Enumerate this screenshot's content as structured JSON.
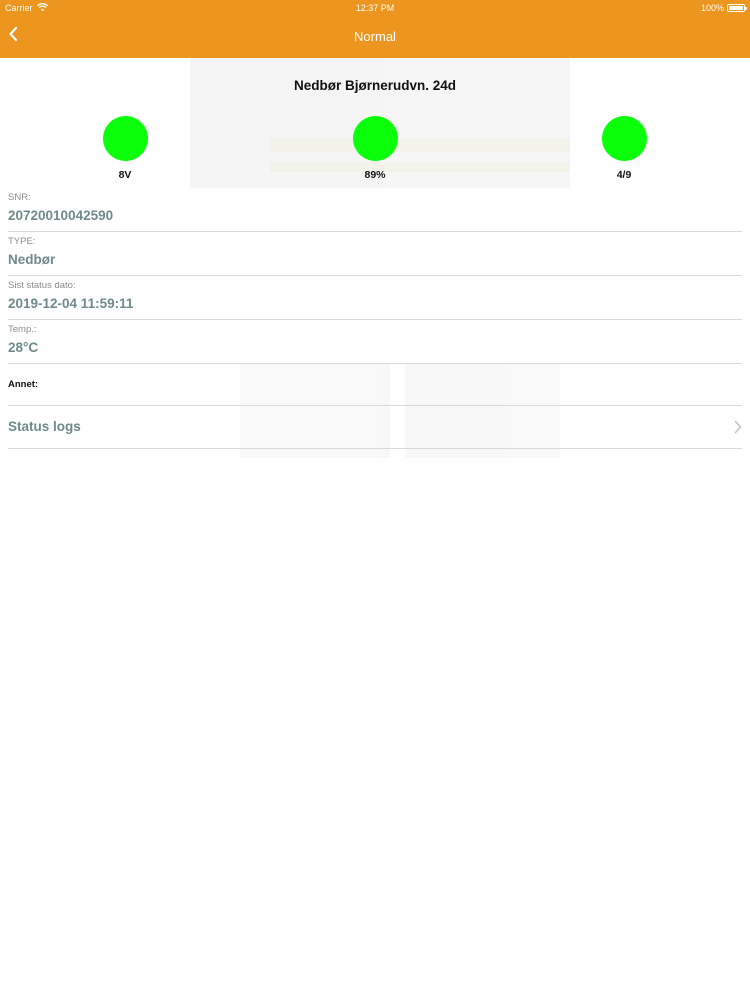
{
  "status_bar": {
    "carrier": "Carrier",
    "time": "12:37 PM",
    "battery": "100%"
  },
  "nav": {
    "title": "Normal",
    "back_icon": "chevron-left-icon"
  },
  "device": {
    "name": "Nedbør Bjørnerudvn. 24d"
  },
  "indicators": [
    {
      "label": "8V",
      "color": "#0bff0b"
    },
    {
      "label": "89%",
      "color": "#0bff0b"
    },
    {
      "label": "4/9",
      "color": "#0bff0b"
    }
  ],
  "fields": [
    {
      "label": "SNR:",
      "value": "20720010042590"
    },
    {
      "label": "TYPE:",
      "value": "Nedbør"
    },
    {
      "label": "Sist status dato:",
      "value": "2019-12-04 11:59:11"
    },
    {
      "label": "Temp.:",
      "value": "28°C"
    }
  ],
  "annet": {
    "label": "Annet:"
  },
  "status_logs": {
    "label": "Status logs"
  },
  "colors": {
    "header": "#ec961f",
    "indicator_ok": "#0bff0b",
    "value_text": "#6e8a8a"
  }
}
